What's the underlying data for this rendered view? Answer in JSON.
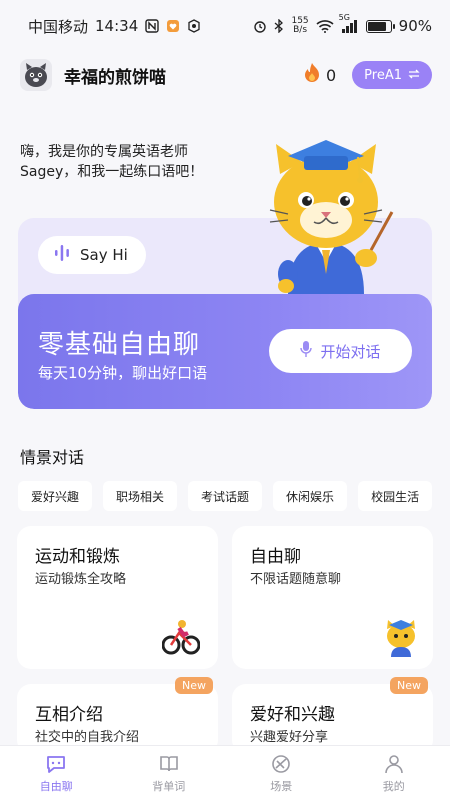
{
  "status_bar": {
    "carrier": "中国移动",
    "time": "14:34",
    "net_speed_value": "155",
    "net_speed_unit": "B/s",
    "network": "5G",
    "battery": "90%",
    "battery_level": 0.9
  },
  "header": {
    "username": "幸福的煎饼喵",
    "fire_count": "0",
    "level_label": "PreA1",
    "level_icon": "swap-icon"
  },
  "greeting": {
    "line1": "嗨，我是你的专属英语老师",
    "line2": "Sagey，和我一起练口语吧！"
  },
  "say_hi": {
    "label": "Say Hi"
  },
  "free_chat": {
    "title": "零基础自由聊",
    "subtitle": "每天10分钟，聊出好口语",
    "button_label": "开始对话"
  },
  "scenes": {
    "title": "情景对话",
    "chips": [
      "爱好兴趣",
      "职场相关",
      "考试话题",
      "休闲娱乐",
      "校园生活"
    ]
  },
  "cards": [
    {
      "title": "运动和锻炼",
      "subtitle": "运动锻炼全攻略",
      "badge": ""
    },
    {
      "title": "自由聊",
      "subtitle": "不限话题随意聊",
      "badge": ""
    },
    {
      "title": "互相介绍",
      "subtitle": "社交中的自我介绍",
      "badge": "New"
    },
    {
      "title": "爱好和兴趣",
      "subtitle": "兴趣爱好分享",
      "badge": "New"
    }
  ],
  "bottom_nav": [
    {
      "label": "自由聊",
      "icon": "chat-icon",
      "active": true
    },
    {
      "label": "背单词",
      "icon": "book-icon",
      "active": false
    },
    {
      "label": "场景",
      "icon": "scene-icon",
      "active": false
    },
    {
      "label": "我的",
      "icon": "user-icon",
      "active": false
    }
  ],
  "colors": {
    "accent": "#8a76f0",
    "panel_gradient_start": "#7b76ec",
    "panel_gradient_end": "#9e96f7",
    "badge": "#f4a460",
    "card_bg": "#ebe8fb"
  }
}
